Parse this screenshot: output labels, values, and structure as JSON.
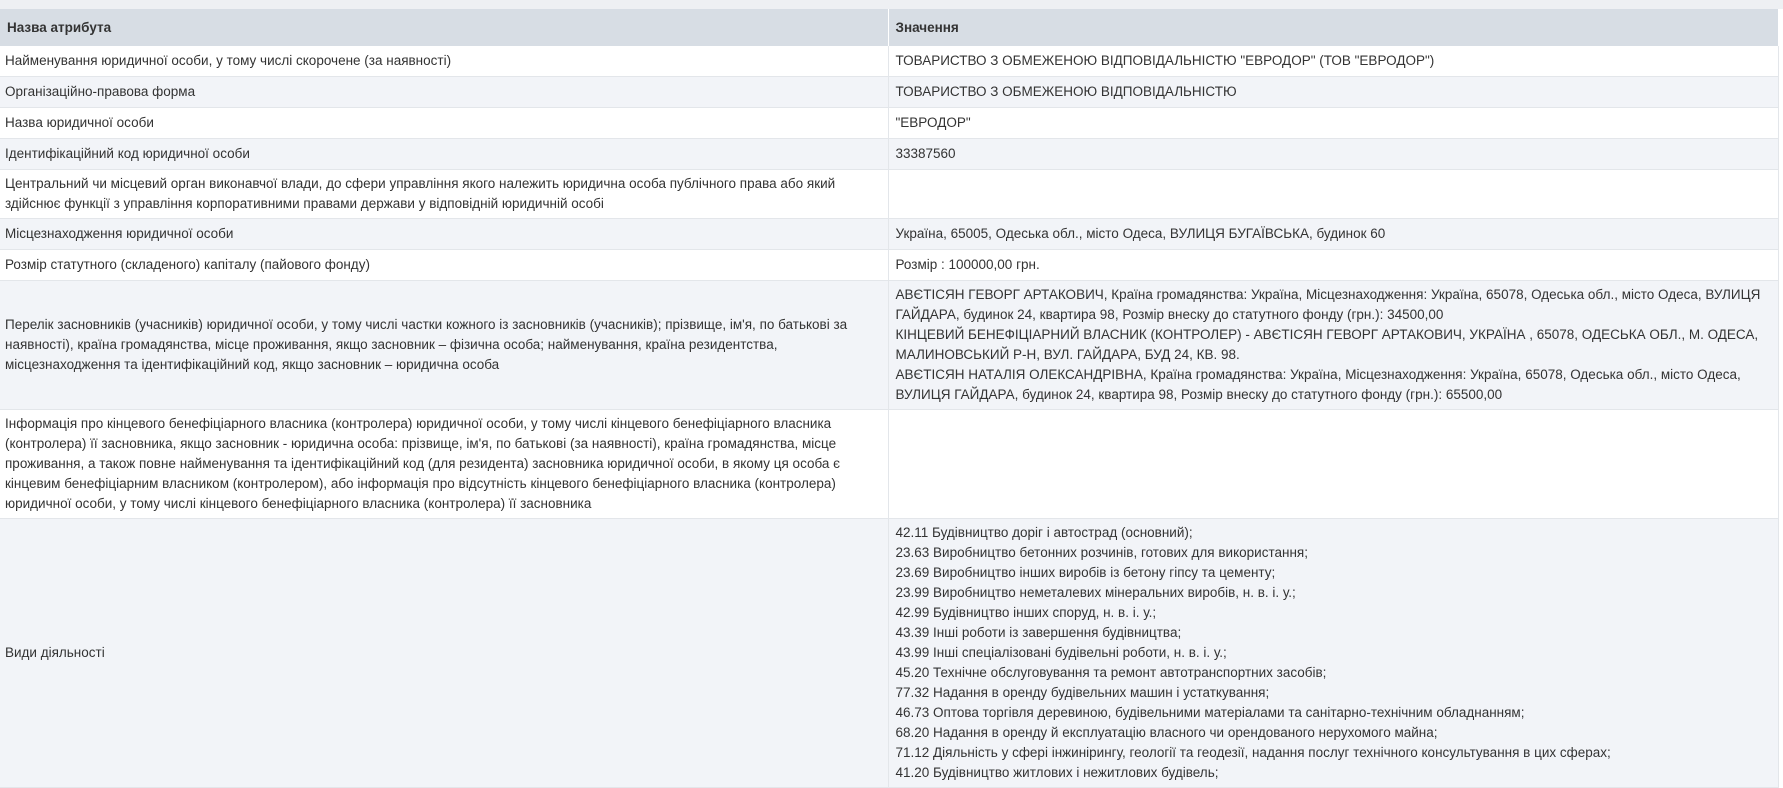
{
  "table": {
    "headers": [
      "Назва атрибута",
      "Значення"
    ],
    "rows": [
      {
        "attribute": "Найменування юридичної особи, у тому числі скорочене (за наявності)",
        "value": [
          "ТОВАРИСТВО З ОБМЕЖЕНОЮ ВІДПОВІДАЛЬНІСТЮ \"ЕВРОДОР\" (ТОВ \"ЕВРОДОР\")"
        ]
      },
      {
        "attribute": "Організаційно-правова форма",
        "value": [
          "ТОВАРИСТВО З ОБМЕЖЕНОЮ ВІДПОВІДАЛЬНІСТЮ"
        ]
      },
      {
        "attribute": "Назва юридичної особи",
        "value": [
          "\"ЕВРОДОР\""
        ]
      },
      {
        "attribute": "Ідентифікаційний код юридичної особи",
        "value": [
          "33387560"
        ]
      },
      {
        "attribute": "Центральний чи місцевий орган виконавчої влади, до сфери управління якого належить юридична особа публічного права або який здійснює функції з управління корпоративними правами держави у відповідній юридичній особі",
        "value": []
      },
      {
        "attribute": "Місцезнаходження юридичної особи",
        "value": [
          "Україна, 65005, Одеська обл., місто Одеса, ВУЛИЦЯ БУГАЇВСЬКА, будинок 60"
        ]
      },
      {
        "attribute": "Розмір статутного (складеного) капіталу (пайового фонду)",
        "value": [
          "Розмір : 100000,00 грн."
        ]
      },
      {
        "attribute": "Перелік засновників (учасників) юридичної особи, у тому числі частки кожного із засновників (учасників); прізвище, ім'я, по батькові за наявності), країна громадянства, місце проживання, якщо засновник – фізична особа; найменування, країна резидентства, місцезнаходження та ідентифікаційний код, якщо засновник – юридична особа",
        "value": [
          "АВЄТІСЯН ГЕВОРГ АРТАКОВИЧ, Країна громадянства: Україна, Місцезнаходження: Україна, 65078, Одеська обл., місто Одеса, ВУЛИЦЯ ГАЙДАРА, будинок 24, квартира 98, Розмір внеску до статутного фонду (грн.): 34500,00",
          "КІНЦЕВИЙ БЕНЕФІЦІАРНИЙ ВЛАСНИК (КОНТРОЛЕР) - АВЄТІСЯН ГЕВОРГ АРТАКОВИЧ, УКРАЇНА , 65078, ОДЕСЬКА ОБЛ., М. ОДЕСА, МАЛИНОВСЬКИЙ Р-Н, ВУЛ. ГАЙДАРА, БУД 24, КВ. 98.",
          "АВЄТІСЯН НАТАЛІЯ ОЛЕКСАНДРІВНА, Країна громадянства: Україна, Місцезнаходження: Україна, 65078, Одеська обл., місто Одеса, ВУЛИЦЯ ГАЙДАРА, будинок 24, квартира 98, Розмір внеску до статутного фонду (грн.): 65500,00"
        ]
      },
      {
        "attribute": "Інформація про кінцевого бенефіціарного власника (контролера) юридичної особи, у тому числі кінцевого бенефіціарного власника (контролера) її засновника, якщо засновник - юридична особа: прізвище, ім'я, по батькові (за наявності), країна громадянства, місце проживання, а також повне найменування та ідентифікаційний код (для резидента) засновника юридичної особи, в якому ця особа є кінцевим бенефіціарним власником (контролером), або інформація про відсутність кінцевого бенефіціарного власника (контролера) юридичної особи, у тому числі кінцевого бенефіціарного власника (контролера) її засновника",
        "value": []
      },
      {
        "attribute": "Види діяльності",
        "value": [
          "42.11 Будівництво доріг і автострад (основний);",
          "23.63 Виробництво бетонних розчинів, готових для використання;",
          "23.69 Виробництво інших виробів із бетону гіпсу та цементу;",
          "23.99 Виробництво неметалевих мінеральних виробів, н. в. і. у.;",
          "42.99 Будівництво інших споруд, н. в. і. у.;",
          "43.39 Інші роботи із завершення будівництва;",
          "43.99 Інші спеціалізовані будівельні роботи, н. в. і. у.;",
          "45.20 Технічне обслуговування та ремонт автотранспортних засобів;",
          "77.32 Надання в оренду будівельних машин і устаткування;",
          "46.73 Оптова торгівля деревиною, будівельними матеріалами та санітарно-технічним обладнанням;",
          "68.20 Надання в оренду й експлуатацію власного чи орендованого нерухомого майна;",
          "71.12 Діяльність у сфері інжинірингу, геології та геодезії, надання послуг технічного консультування в цих сферах;",
          "41.20 Будівництво житлових і нежитлових будівель;"
        ]
      }
    ]
  }
}
